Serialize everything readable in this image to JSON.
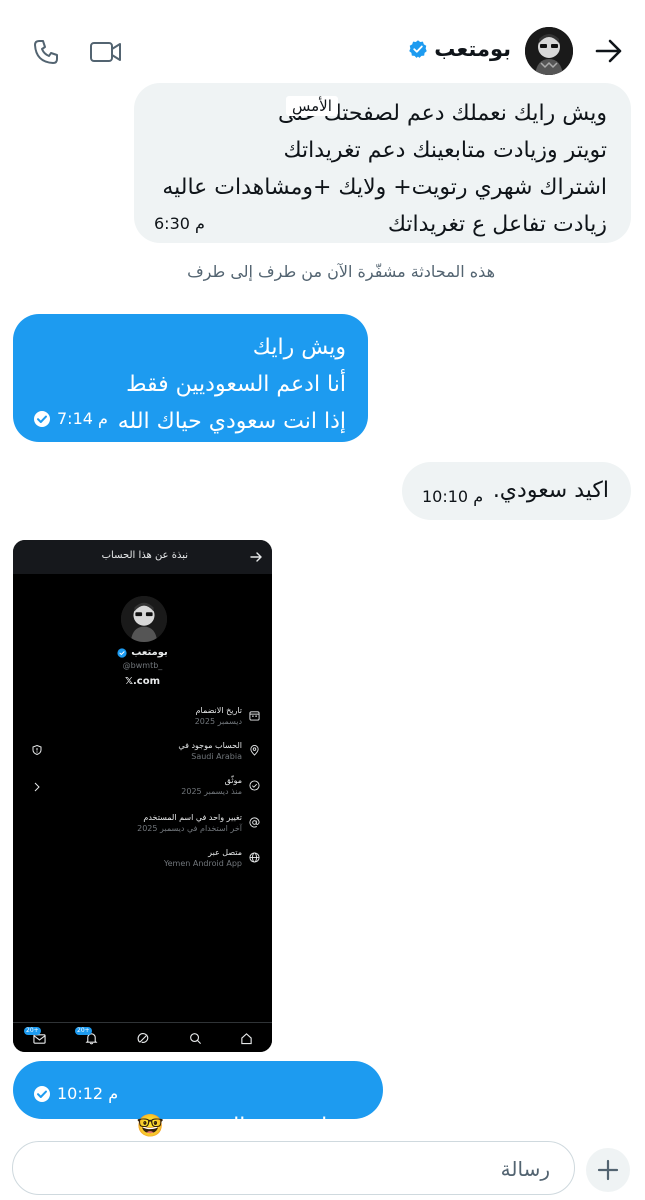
{
  "header": {
    "back_icon": "arrow-right-icon",
    "name": "بومتعب",
    "verified_icon": "verified-badge-icon",
    "call_icon": "phone-icon",
    "video_icon": "video-camera-icon"
  },
  "messages": [
    {
      "direction": "incoming",
      "text": "ويش رايك نعملك دعم لصفحتك على\nتويتر وزيادت متابعينك دعم تغريداتك\nاشتراك شهري رتويت+ ولايك +ومشاهدات عاليه\nزيادت تفاعل ع تغريداتك",
      "time": "6:30 م",
      "overlay_label": "الأمس"
    },
    {
      "direction": "outgoing",
      "text": "ويش رايك\nأنا ادعم السعوديين فقط\nإذا انت سعودي حياك الله",
      "time": "7:14 م",
      "status_icon": "sent-check-icon"
    },
    {
      "direction": "incoming",
      "text": "اكيد سعودي.",
      "time": "10:10 م"
    },
    {
      "direction": "outgoing",
      "text": "وهذا وش ي السعودي",
      "emoji": "🤓",
      "time": "10:12 م",
      "status_icon": "sent-check-icon"
    }
  ],
  "encryption_notice": "هذه المحادثة مشفّرة الآن من طرف إلى طرف",
  "attachment": {
    "title": "نبذة عن هذا الحساب",
    "name": "بومتعب",
    "handle": "@bwmtb_",
    "site": "𝕏.com",
    "rows": [
      {
        "icon": "calendar-icon",
        "label": "تاريخ الانضمام",
        "value": "ديسمبر 2025"
      },
      {
        "icon": "location-icon",
        "label": "الحساب موجود في",
        "value": "Saudi Arabia"
      },
      {
        "icon": "verified-check-icon",
        "label": "موثّق",
        "value": "منذ ديسمبر 2025"
      },
      {
        "icon": "at-icon",
        "label": "تغيير واحد في اسم المستخدم",
        "value": "آخر استخدام في ديسمبر 2025"
      },
      {
        "icon": "globe-icon",
        "label": "متصل عبر",
        "value": "Yemen Android App"
      }
    ],
    "nav": {
      "mail_badge": "20+",
      "notif_badge": "20+",
      "icons": [
        "mail-icon",
        "bell-icon",
        "grok-icon",
        "search-icon",
        "home-icon"
      ]
    }
  },
  "composer": {
    "placeholder": "رسالة",
    "add_icon": "plus-icon"
  },
  "colors": {
    "accent": "#1d9bf0",
    "incoming_bubble": "#eff3f4",
    "muted_text": "#536471"
  }
}
